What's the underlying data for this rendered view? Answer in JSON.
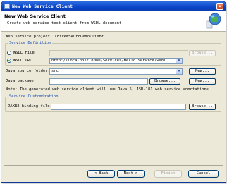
{
  "window": {
    "title": "New Web Service Client",
    "close_glyph": "×"
  },
  "header": {
    "title": "New Web Service Client",
    "subtitle": "Create web service test client from WSDL document",
    "icon": "wsdl-globe-wizard-icon"
  },
  "project": {
    "label": "Web service project: XFireWSAutoDemoClient"
  },
  "service_definition": {
    "group_title": "Service Definition",
    "wsdl_file": {
      "label": "WSDL File",
      "value": "",
      "browse_label": "Browse...",
      "selected": false
    },
    "wsdl_url": {
      "label": "WSDL URL",
      "value": "http://localhost:8080/Services/Hello.Service?wsdl",
      "selected": true
    }
  },
  "java_source_folder": {
    "label": "Java source folder:",
    "value": "src",
    "new_label": "New..."
  },
  "java_package": {
    "label": "Java package:",
    "value": "",
    "browse_label": "Browse...",
    "new_label": "New..."
  },
  "note": "Note: The generated web service client will use Java 5, JSR-181 web service annotations",
  "service_customization": {
    "group_title": "Service Customization",
    "jaxb_label": "JAXB2 binding file:",
    "jaxb_value": "",
    "browse_label": "Browse..."
  },
  "footer": {
    "back_label": "Back",
    "next_label": "Next",
    "finish_label": "Finish",
    "cancel_label": "Cancel"
  },
  "colors": {
    "titlebar": "#0a44c6",
    "group_title": "#1a4fb8",
    "dialog_bg": "#ece9d8"
  }
}
